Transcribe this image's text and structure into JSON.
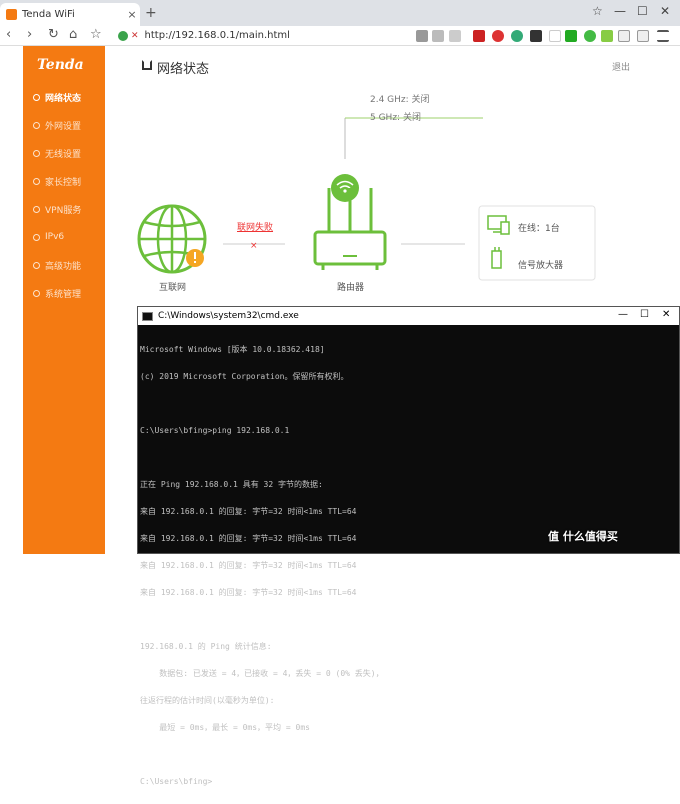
{
  "browser": {
    "tab_title": "Tenda WiFi",
    "tab_close": "×",
    "new_tab": "+",
    "url": "http://192.168.0.1/main.html",
    "insecure": "不安全"
  },
  "router": {
    "brand": "Tenda",
    "page_title": "网络状态",
    "logout": "退出",
    "nav": [
      {
        "label": "网络状态"
      },
      {
        "label": "外网设置"
      },
      {
        "label": "无线设置"
      },
      {
        "label": "家长控制"
      },
      {
        "label": "VPN服务"
      },
      {
        "label": "IPv6"
      },
      {
        "label": "高级功能"
      },
      {
        "label": "系统管理"
      }
    ],
    "wifi_24": "2.4 GHz: 关闭",
    "wifi_5": "5 GHz: 关闭",
    "link_fail": "联网失败",
    "internet": "互联网",
    "router_label": "路由器",
    "online": "在线：1台",
    "repeater": "信号放大器"
  },
  "cmd": {
    "title": "C:\\Windows\\system32\\cmd.exe",
    "lines": [
      "Microsoft Windows [版本 10.0.18362.418]",
      "(c) 2019 Microsoft Corporation。保留所有权利。",
      "",
      "C:\\Users\\bfing>ping 192.168.0.1",
      "",
      "正在 Ping 192.168.0.1 具有 32 字节的数据:",
      "来自 192.168.0.1 的回复: 字节=32 时间<1ms TTL=64",
      "来自 192.168.0.1 的回复: 字节=32 时间<1ms TTL=64",
      "来自 192.168.0.1 的回复: 字节=32 时间<1ms TTL=64",
      "来自 192.168.0.1 的回复: 字节=32 时间<1ms TTL=64",
      "",
      "192.168.0.1 的 Ping 统计信息:",
      "    数据包: 已发送 = 4，已接收 = 4，丢失 = 0 (0% 丢失)，",
      "往返行程的估计时间(以毫秒为单位):",
      "    最短 = 0ms，最长 = 0ms，平均 = 0ms",
      "",
      "C:\\Users\\bfing>"
    ]
  },
  "watermark": "值 什么值得买",
  "colors": {
    "accent": "#f47a12",
    "green": "#6cbf3b"
  }
}
